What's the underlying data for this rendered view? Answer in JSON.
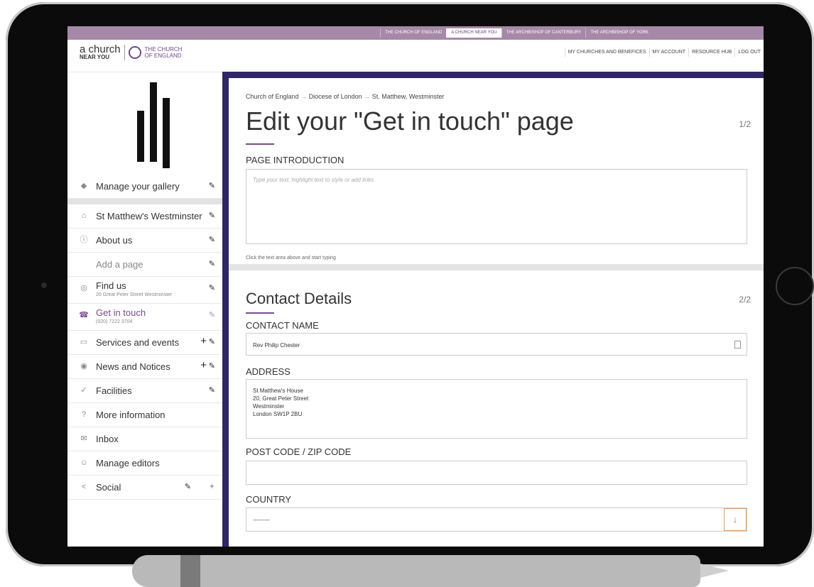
{
  "top_links": [
    "THE CHURCH OF ENGLAND",
    "A CHURCH NEAR YOU",
    "THE ARCHBISHOP OF CANTERBURY",
    "THE ARCHBISHOP OF YORK"
  ],
  "logo": {
    "a_church": "a church",
    "near_you": "NEAR YOU",
    "coe_line1": "THE CHURCH",
    "coe_line2": "OF ENGLAND"
  },
  "user_nav": [
    "MY CHURCHES AND BENEFICES",
    "MY ACCOUNT",
    "RESOURCE HUB",
    "LOG OUT"
  ],
  "sidebar": {
    "items": [
      {
        "label": "Manage your gallery",
        "icon": "diamond-arrow-icon"
      },
      {
        "label": "St Matthew's Westminster",
        "icon": "home-icon"
      },
      {
        "label": "About us",
        "icon": "info-icon"
      },
      {
        "label": "Add a page"
      },
      {
        "label": "Find us",
        "sub": "20 Great Peter Street Westminster",
        "icon": "compass-icon"
      },
      {
        "label": "Get in touch",
        "sub": "(020) 7222 3704",
        "icon": "phone-icon"
      },
      {
        "label": "Services and events",
        "icon": "calendar-icon"
      },
      {
        "label": "News and Notices",
        "icon": "broadcast-icon"
      },
      {
        "label": "Facilities",
        "icon": "check-circle-icon"
      },
      {
        "label": "More information",
        "icon": "question-icon"
      },
      {
        "label": "Inbox",
        "icon": "envelope-icon"
      },
      {
        "label": "Manage editors",
        "icon": "user-circle-icon"
      },
      {
        "label": "Social",
        "icon": "share-icon"
      }
    ]
  },
  "page": {
    "breadcrumb": [
      "Church of England",
      "Diocese of London",
      "St. Matthew, Westminster"
    ],
    "breadcrumb_sep": "→",
    "title": "Edit your \"Get in touch\" page",
    "step1": "1/2",
    "intro_label": "PAGE INTRODUCTION",
    "intro_placeholder": "Type your text, highlight text to style or add links",
    "intro_hint": "Click the text area above and start typing",
    "section2_title": "Contact Details",
    "step2": "2/2",
    "contact_name_label": "CONTACT NAME",
    "contact_name_value": "Rev Philip Chester",
    "address_label": "ADDRESS",
    "address_lines": [
      "St Matthew's House",
      "20, Great Peter Street",
      "Westminster",
      "London  SW1P 2BU"
    ],
    "postcode_label": "POST CODE / ZIP CODE",
    "postcode_value": "",
    "country_label": "COUNTRY",
    "country_value": "---------"
  }
}
